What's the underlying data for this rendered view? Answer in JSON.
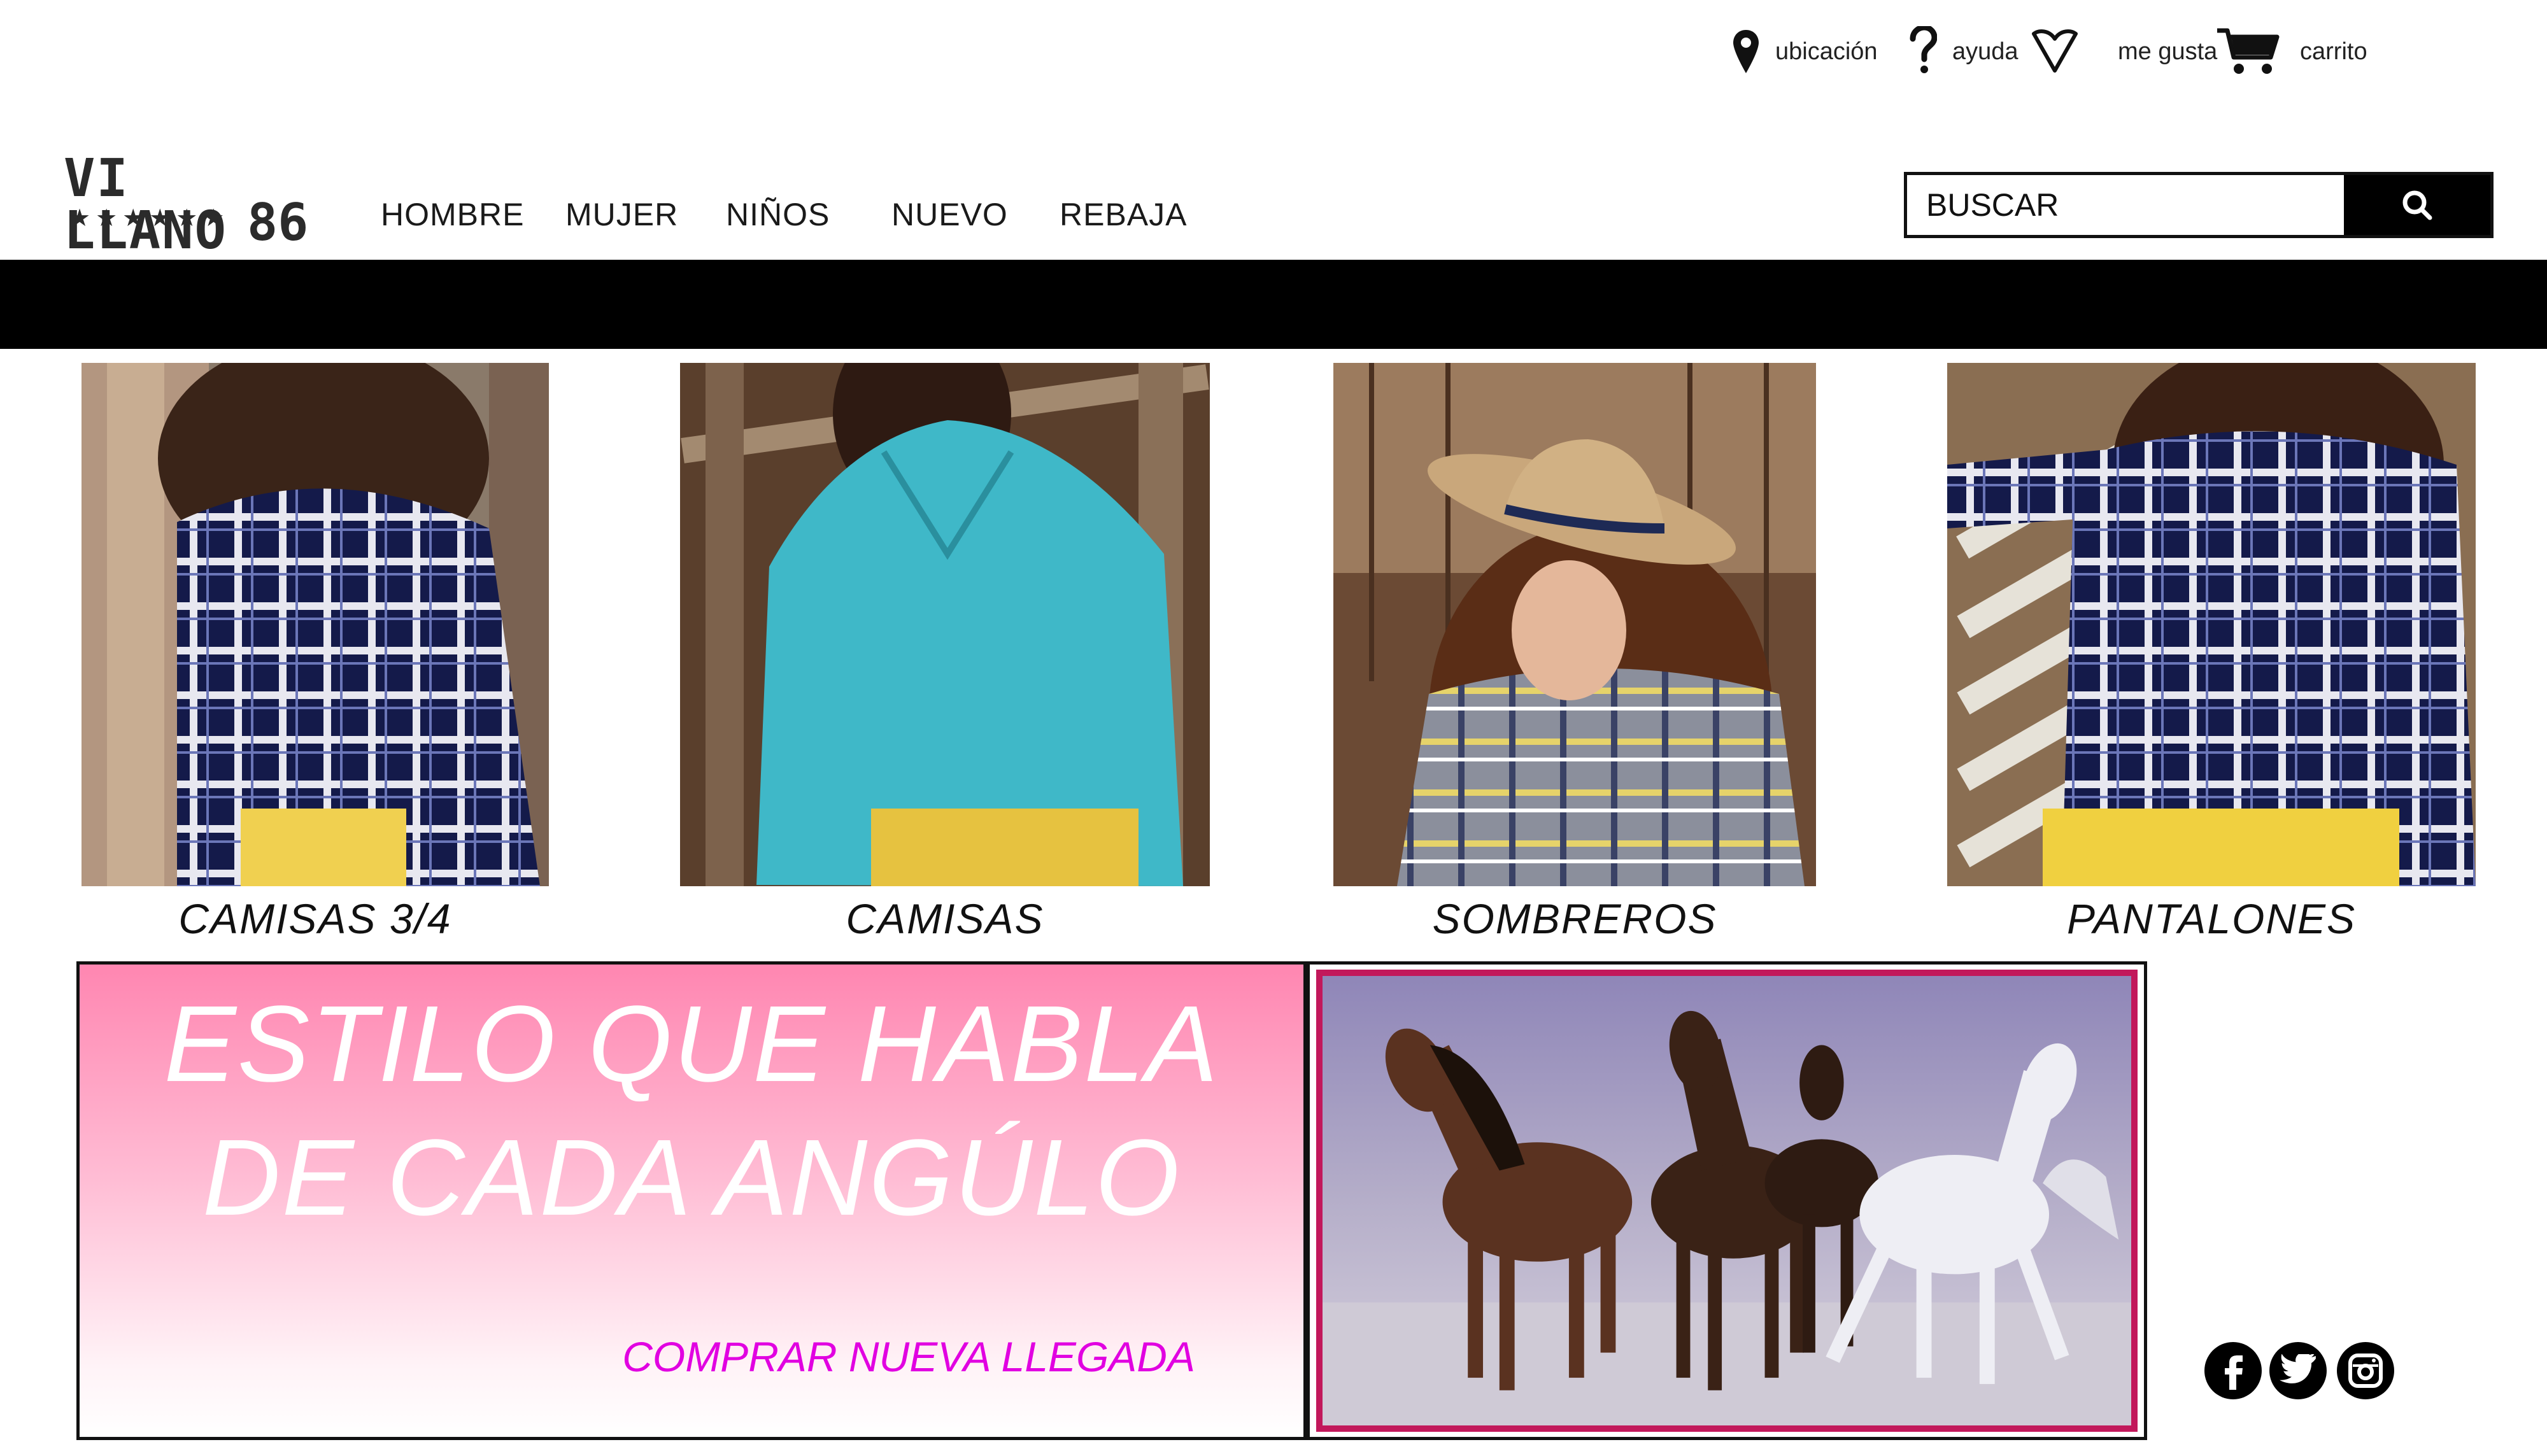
{
  "utility": {
    "location_label": "ubicación",
    "help_label": "ayuda",
    "like_label": "me gusta",
    "cart_label": "carrito"
  },
  "logo": {
    "line1": "VI LLANO",
    "stars": "★★★★★★",
    "number": "86"
  },
  "nav": [
    "HOMBRE",
    "MUJER",
    "NIÑOS",
    "NUEVO",
    "REBAJA"
  ],
  "search": {
    "placeholder": "BUSCAR"
  },
  "categories": [
    {
      "label": "CAMISAS 3/4"
    },
    {
      "label": "CAMISAS"
    },
    {
      "label": "SOMBREROS"
    },
    {
      "label": "PANTALONES"
    }
  ],
  "promo": {
    "headline_line1": "ESTILO QUE HABLA",
    "headline_line2": "DE CADA ANGÚLO",
    "cta": "COMPRAR NUEVA LLEGADA"
  },
  "social": [
    "facebook",
    "twitter",
    "instagram"
  ],
  "colors": {
    "band": "#000000",
    "promo_pink": "#ff86b1",
    "cta_magenta": "#e100e1",
    "photo_frame": "#c2185b"
  }
}
